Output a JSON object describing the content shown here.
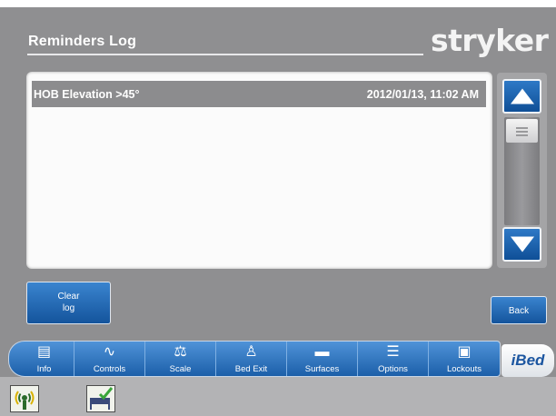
{
  "header": {
    "title": "Reminders Log",
    "brand": "stryker"
  },
  "log": {
    "entries": [
      {
        "name": "HOB Elevation >45°",
        "time": "2012/01/13, 11:02 AM"
      }
    ]
  },
  "buttons": {
    "clear_log_line1": "Clear",
    "clear_log_line2": "log",
    "back": "Back"
  },
  "nav": {
    "items": [
      {
        "label": "Info",
        "icon": "info-icon"
      },
      {
        "label": "Controls",
        "icon": "bed-controls-icon"
      },
      {
        "label": "Scale",
        "icon": "scale-icon"
      },
      {
        "label": "Bed Exit",
        "icon": "bed-exit-icon"
      },
      {
        "label": "Surfaces",
        "icon": "surfaces-icon"
      },
      {
        "label": "Options",
        "icon": "options-sliders-icon"
      },
      {
        "label": "Lockouts",
        "icon": "lock-icon"
      }
    ],
    "brand_tab": "iBed"
  },
  "status": {
    "icons": [
      "wifi-signal-icon",
      "bed-check-icon"
    ]
  },
  "colors": {
    "background": "#8f8f91",
    "accent_blue": "#1c5fa9",
    "panel": "#fbfbfb"
  }
}
